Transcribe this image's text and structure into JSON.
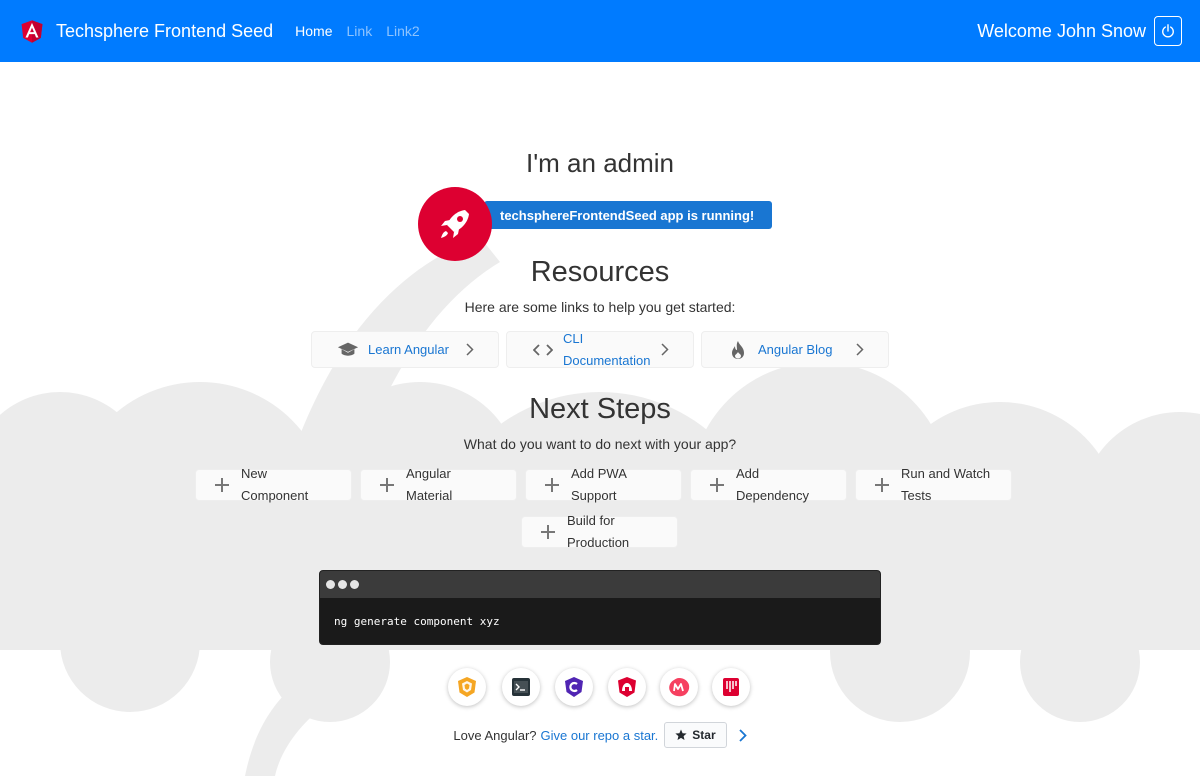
{
  "navbar": {
    "brand": "Techsphere Frontend Seed",
    "links": [
      {
        "label": "Home",
        "active": true
      },
      {
        "label": "Link",
        "active": false
      },
      {
        "label": "Link2",
        "active": false
      }
    ],
    "welcome": "Welcome John Snow",
    "color": "#007bff"
  },
  "main": {
    "admin_heading": "I'm an admin",
    "running_badge": "techsphereFrontendSeed app is running!",
    "resources": {
      "title": "Resources",
      "subtitle": "Here are some links to help you get started:",
      "cards": [
        {
          "line1": "Learn Angular",
          "line2": "",
          "icon": "graduation-cap-icon"
        },
        {
          "line1": "CLI",
          "line2": "Documentation",
          "icon": "code-icon"
        },
        {
          "line1": "Angular Blog",
          "line2": "",
          "icon": "flame-icon"
        }
      ]
    },
    "next_steps": {
      "title": "Next Steps",
      "subtitle": "What do you want to do next with your app?",
      "cards": [
        {
          "line1": "New",
          "line2": "Component"
        },
        {
          "line1": "Angular",
          "line2": "Material"
        },
        {
          "line1": "Add PWA",
          "line2": "Support"
        },
        {
          "line1": "Add",
          "line2": "Dependency"
        },
        {
          "line1": "Run and Watch",
          "line2": "Tests"
        },
        {
          "line1": "Build for",
          "line2": "Production"
        }
      ]
    },
    "terminal_command": "ng generate component xyz",
    "circle_links": [
      {
        "icon": "animations-icon",
        "color": "#f5a623"
      },
      {
        "icon": "cli-icon",
        "color": "#263238"
      },
      {
        "icon": "meetup-icon",
        "color": "#5025b3"
      },
      {
        "icon": "angular-shield-icon",
        "color": "#dd0031"
      },
      {
        "icon": "meetup-m-icon",
        "color": "#f64060"
      },
      {
        "icon": "discord-icon",
        "color": "#dd0031"
      }
    ],
    "footer": {
      "love": "Love Angular?",
      "give": "Give our repo a star.",
      "star_label": "Star"
    }
  }
}
